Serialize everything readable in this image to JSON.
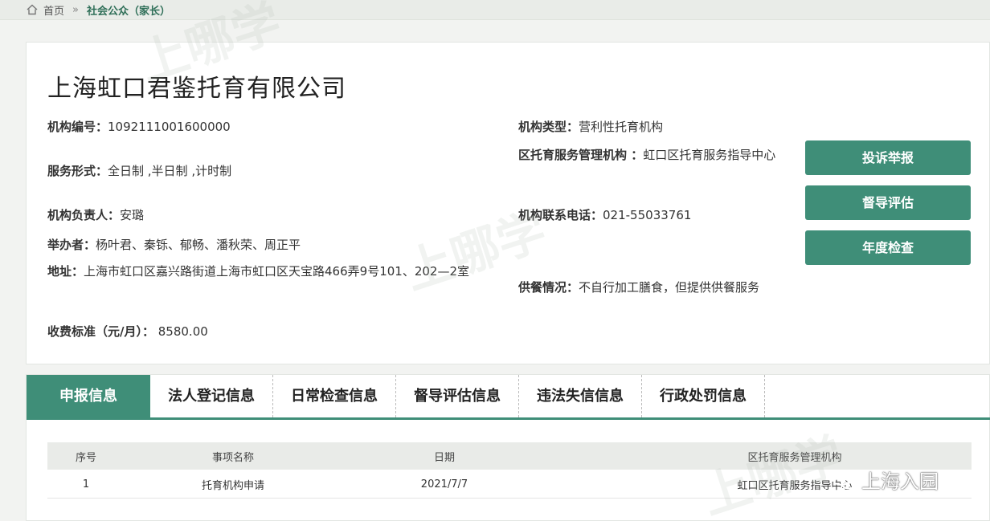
{
  "breadcrumb": {
    "home_label": "首页",
    "separator": "»",
    "current_label": "社会公众（家长）"
  },
  "institution": {
    "name": "上海虹口君鉴托育有限公司",
    "fields": {
      "code": {
        "label": "机构编号：",
        "value": "1092111001600000"
      },
      "service_form": {
        "label": "服务形式：",
        "value": "全日制 ,半日制 ,计时制"
      },
      "principal": {
        "label": "机构负责人：",
        "value": "安璐"
      },
      "founders": {
        "label": "举办者：",
        "value": "杨叶君、秦铄、郁畅、潘秋荣、周正平"
      },
      "address": {
        "label": "地址：",
        "value": "上海市虹口区嘉兴路街道上海市虹口区天宝路466弄9号101、202—2室"
      },
      "fee": {
        "label": "收费标准（元/月）：",
        "value": " 8580.00"
      },
      "type": {
        "label": "机构类型：",
        "value": "营利性托育机构"
      },
      "district_admin": {
        "label": "区托育服务管理机构 ：",
        "value": "虹口区托育服务指导中心"
      },
      "phone": {
        "label": "机构联系电话：",
        "value": "021-55033761"
      },
      "catering": {
        "label": "供餐情况：",
        "value": "不自行加工膳食，但提供供餐服务"
      }
    }
  },
  "actions": {
    "complaint": "投诉举报",
    "supervision": "督导评估",
    "annual_check": "年度检查"
  },
  "tabs": [
    {
      "label": "申报信息",
      "active": true
    },
    {
      "label": "法人登记信息",
      "active": false
    },
    {
      "label": "日常检查信息",
      "active": false
    },
    {
      "label": "督导评估信息",
      "active": false
    },
    {
      "label": "违法失信信息",
      "active": false
    },
    {
      "label": "行政处罚信息",
      "active": false
    }
  ],
  "table": {
    "columns": [
      "序号",
      "事项名称",
      "日期",
      "区托育服务管理机构"
    ],
    "rows": [
      [
        "1",
        "托育机构申请",
        "2021/7/7",
        "虹口区托育服务指导中心"
      ]
    ]
  },
  "watermarks": {
    "site_mark": "上哪学",
    "wechat_account": "上海入园"
  },
  "colors": {
    "accent": "#3f8e78",
    "breadcrumb_current": "#2f6f58"
  },
  "icons": {
    "home": "home-icon",
    "wechat": "wechat-icon"
  }
}
